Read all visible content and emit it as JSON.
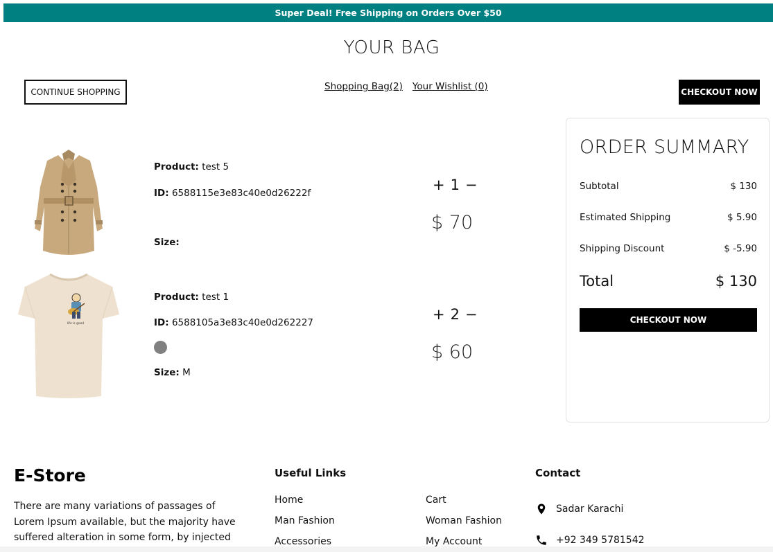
{
  "announcement": "Super Deal! Free Shipping on Orders Over $50",
  "page": {
    "title": "YOUR BAG",
    "continue_label": "CONTINUE SHOPPING",
    "shopping_bag_link": "Shopping Bag(2)",
    "wishlist_link": "Your Wishlist (0)",
    "checkout_label": "CHECKOUT NOW"
  },
  "cart": {
    "items": [
      {
        "product_label": "Product:",
        "product_name": "test 5",
        "id_label": "ID:",
        "id_value": "6588115e3e83c40e0d26222f",
        "size_label": "Size:",
        "size_value": "",
        "quantity": "1",
        "price": "$ 70",
        "image": "trench-coat"
      },
      {
        "product_label": "Product:",
        "product_name": "test 1",
        "id_label": "ID:",
        "id_value": "6588105a3e83c40e0d262227",
        "size_label": "Size:",
        "size_value": "M",
        "quantity": "2",
        "price": "$ 60",
        "color": "#808080",
        "image": "t-shirt"
      }
    ],
    "plus_symbol": "+",
    "minus_symbol": "−"
  },
  "summary": {
    "title": "ORDER SUMMARY",
    "subtotal_label": "Subtotal",
    "subtotal_value": "$ 130",
    "shipping_label": "Estimated Shipping",
    "shipping_value": "$ 5.90",
    "discount_label": "Shipping Discount",
    "discount_value": "$ -5.90",
    "total_label": "Total",
    "total_value": "$ 130",
    "checkout_label": "CHECKOUT NOW"
  },
  "footer": {
    "brand": "E-Store",
    "description": "There are many variations of passages of Lorem Ipsum available, but the majority have suffered alteration in some form, by injected humour, or",
    "useful_links_title": "Useful Links",
    "links": [
      "Home",
      "Cart",
      "Man Fashion",
      "Woman Fashion",
      "Accessories",
      "My Account"
    ],
    "contact_title": "Contact",
    "address": "Sadar Karachi",
    "phone": "+92 349 5781542"
  },
  "colors": {
    "announcement_bg": "#008080",
    "button_dark": "#000000",
    "swatch": "#808080"
  }
}
